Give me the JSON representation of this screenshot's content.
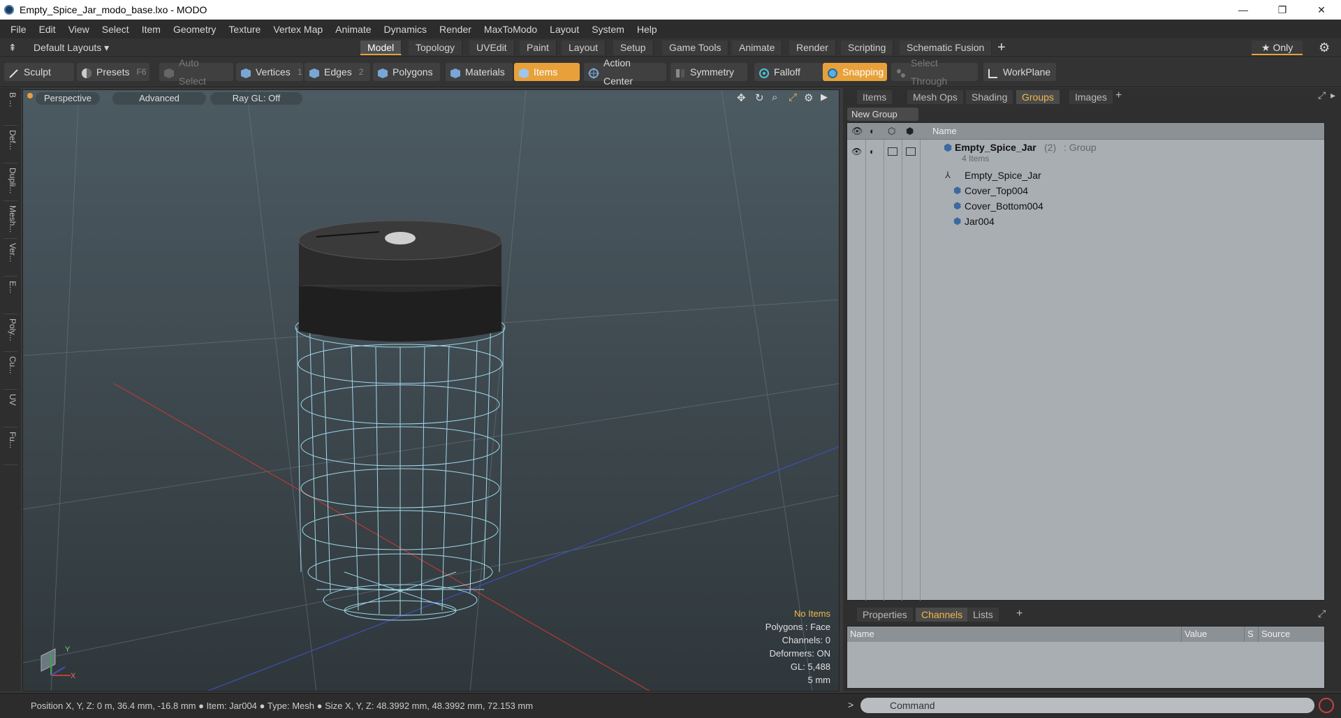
{
  "window": {
    "title": "Empty_Spice_Jar_modo_base.lxo - MODO",
    "minimize": "—",
    "maximize": "❐",
    "close": "✕"
  },
  "menu": [
    "File",
    "Edit",
    "View",
    "Select",
    "Item",
    "Geometry",
    "Texture",
    "Vertex Map",
    "Animate",
    "Dynamics",
    "Render",
    "MaxToModo",
    "Layout",
    "System",
    "Help"
  ],
  "layoutbar": {
    "layouts_label": "Default Layouts ▾",
    "tabs": [
      "Model",
      "Topology",
      "UVEdit",
      "Paint",
      "Layout",
      "Setup",
      "Game Tools",
      "Animate",
      "Render",
      "Scripting",
      "Schematic Fusion"
    ],
    "active_tab": "Model",
    "add": "+",
    "only_label": "★  Only"
  },
  "toolbar": {
    "sculpt": "Sculpt",
    "presets": "Presets",
    "presets_key": "F6",
    "auto_select": "Auto Select",
    "vertices": "Vertices",
    "vertices_num": "1",
    "edges": "Edges",
    "edges_num": "2",
    "polygons": "Polygons",
    "materials": "Materials",
    "items": "Items",
    "action_center": "Action Center",
    "symmetry": "Symmetry",
    "falloff": "Falloff",
    "snapping": "Snapping",
    "select_through": "Select Through",
    "workplane": "WorkPlane"
  },
  "left_tabs": [
    "B ...",
    "Def...",
    "Dupli...",
    "Mesh...",
    "Ver...",
    "E...",
    "Poly...",
    "Cu...",
    "UV",
    "Fu..."
  ],
  "viewport": {
    "perspective": "Perspective",
    "advanced": "Advanced",
    "raygl": "Ray GL: Off",
    "info": {
      "items": "No Items",
      "polygons": "Polygons : Face",
      "channels": "Channels: 0",
      "deformers": "Deformers: ON",
      "gl": "GL: 5,488",
      "unit": "5 mm"
    },
    "axis_y": "Y",
    "axis_x": "X"
  },
  "right_panel": {
    "tabs": [
      "Items",
      "Mesh Ops",
      "Shading",
      "Groups",
      "Images"
    ],
    "active_tab": "Groups",
    "add": "+",
    "new_group": "New Group",
    "name_header": "Name",
    "group": {
      "name": "Empty_Spice_Jar",
      "count": "(2)",
      "type": ": Group",
      "items_count": "4 Items"
    },
    "children": [
      "Empty_Spice_Jar",
      "Cover_Top004",
      "Cover_Bottom004",
      "Jar004"
    ]
  },
  "channels_panel": {
    "tabs": [
      "Properties",
      "Channels",
      "Lists"
    ],
    "active_tab": "Channels",
    "add": "+",
    "headers": {
      "name": "Name",
      "value": "Value",
      "s": "S",
      "source": "Source"
    }
  },
  "status": {
    "position_label": "Position X, Y, Z:",
    "position_value": "0 m, 36.4 mm, -16.8 mm",
    "item_label": "Item:",
    "item_value": "Jar004",
    "type_label": "Type:",
    "type_value": "Mesh",
    "size_label": "Size X, Y, Z:",
    "size_value": "48.3992 mm, 48.3992 mm, 72.153 mm",
    "command_placeholder": "Command",
    "prompt": ">"
  },
  "colors": {
    "accent": "#e8a13a",
    "wire": "#9fd8ea"
  }
}
